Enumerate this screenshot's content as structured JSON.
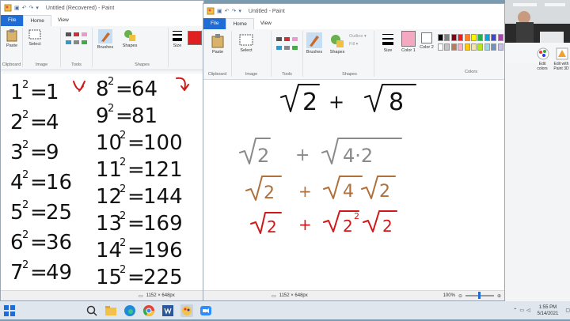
{
  "left_window": {
    "title": "Untitled (Recovered) - Paint",
    "menu": {
      "file": "File",
      "home": "Home",
      "view": "View"
    },
    "groups": {
      "clipboard": "Clipboard",
      "image": "Image",
      "tools": "Tools",
      "shapes": "Shapes"
    },
    "buttons": {
      "paste": "Paste",
      "select": "Select",
      "brushes": "Brushes",
      "shapes": "Shapes",
      "size": "Size"
    },
    "squares_left": [
      {
        "base": "1",
        "exp": "2",
        "result": "1"
      },
      {
        "base": "2",
        "exp": "2",
        "result": "4"
      },
      {
        "base": "3",
        "exp": "2",
        "result": "9"
      },
      {
        "base": "4",
        "exp": "2",
        "result": "16"
      },
      {
        "base": "5",
        "exp": "2",
        "result": "25"
      },
      {
        "base": "6",
        "exp": "2",
        "result": "36"
      },
      {
        "base": "7",
        "exp": "2",
        "result": "49"
      }
    ],
    "squares_right": [
      {
        "base": "8",
        "exp": "2",
        "result": "64"
      },
      {
        "base": "9",
        "exp": "2",
        "result": "81"
      },
      {
        "base": "10",
        "exp": "2",
        "result": "100"
      },
      {
        "base": "11",
        "exp": "2",
        "result": "121"
      },
      {
        "base": "12",
        "exp": "2",
        "result": "144"
      },
      {
        "base": "13",
        "exp": "2",
        "result": "169"
      },
      {
        "base": "14",
        "exp": "2",
        "result": "196"
      },
      {
        "base": "15",
        "exp": "2",
        "result": "225"
      }
    ],
    "status_size": "1152 × 648px"
  },
  "right_window": {
    "title": "Untitled - Paint",
    "menu": {
      "file": "File",
      "home": "Home",
      "view": "View"
    },
    "groups": {
      "clipboard": "Clipboard",
      "image": "Image",
      "tools": "Tools",
      "shapes": "Shapes",
      "colors": "Colors"
    },
    "buttons": {
      "paste": "Paste",
      "select": "Select",
      "brushes": "Brushes",
      "shapes": "Shapes",
      "outline": "Outline",
      "fill": "Fill",
      "size": "Size",
      "color1": "Color 1",
      "color2": "Color 2",
      "edit_colors": "Edit colors",
      "edit_paint3d": "Edit with Paint 3D"
    },
    "equations": {
      "line1": {
        "left": "2",
        "op": "+",
        "right": "8"
      },
      "line2": {
        "left": "2",
        "op": "+",
        "right": "4·2"
      },
      "line3": {
        "left": "2",
        "op": "+",
        "right_a": "4",
        "right_b": "2"
      },
      "line4": {
        "left": "2",
        "op": "+",
        "right_a": "2",
        "right_exp": "2",
        "right_b": "2"
      }
    },
    "ink_colors": {
      "black": "#111111",
      "gray": "#8a8a8a",
      "brown": "#b0703a",
      "red": "#d01818"
    },
    "palette": [
      "#000000",
      "#7f7f7f",
      "#880015",
      "#ed1c24",
      "#ff7f27",
      "#fff200",
      "#22b14c",
      "#00a2e8",
      "#3f48cc",
      "#a349a4",
      "#ffffff",
      "#c3c3c3",
      "#b97a57",
      "#ffaec9",
      "#ffc90e",
      "#efe4b0",
      "#b5e61d",
      "#99d9ea",
      "#7092be",
      "#c8bfe7"
    ],
    "color1": "#f4a9c0",
    "status_size": "1152 × 648px",
    "zoom": "100%"
  },
  "taskbar": {
    "time": "1:55 PM",
    "date": "5/14/2021"
  }
}
